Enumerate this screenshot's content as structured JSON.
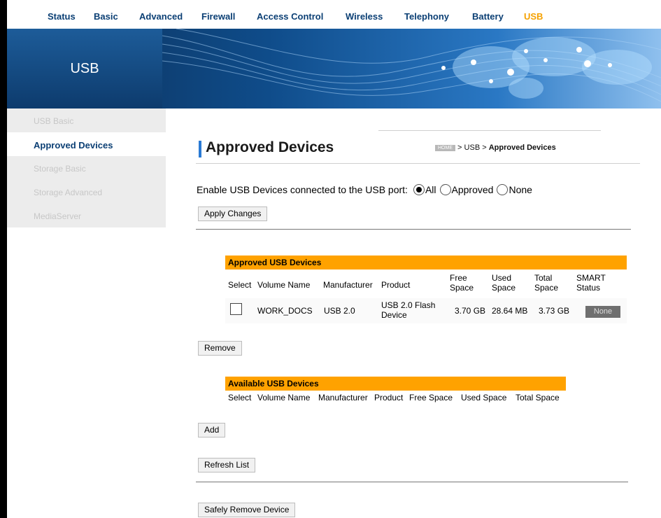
{
  "nav": [
    "Status",
    "Basic",
    "Advanced",
    "Firewall",
    "Access Control",
    "Wireless",
    "Telephony",
    "Battery",
    "USB"
  ],
  "banner": {
    "title": "USB"
  },
  "sidebar": [
    "USB Basic",
    "Approved Devices",
    "Storage Basic",
    "Storage Advanced",
    "MediaServer"
  ],
  "page": {
    "title": "Approved Devices"
  },
  "breadcrumb": {
    "home": "HOME",
    "trail": " > USB > ",
    "current": "Approved Devices"
  },
  "enable": {
    "label": "Enable USB Devices connected to the USB port:",
    "options": [
      "All",
      "Approved",
      "None"
    ],
    "selected": "All"
  },
  "buttons": {
    "apply": "Apply Changes",
    "remove": "Remove",
    "add": "Add",
    "refresh": "Refresh List",
    "safely_remove": "Safely Remove Device"
  },
  "approved": {
    "title": "Approved USB Devices",
    "columns": [
      "Select",
      "Volume Name",
      "Manufacturer",
      "Product",
      "Free Space",
      "Used Space",
      "Total Space",
      "SMART Status"
    ],
    "rows": [
      {
        "volume": "WORK_DOCS",
        "manufacturer": "USB 2.0",
        "product": "USB 2.0 Flash Device",
        "free": "3.70 GB",
        "used": "28.64 MB",
        "total": "3.73 GB",
        "smart": "None"
      }
    ]
  },
  "available": {
    "title": "Available USB Devices",
    "columns": [
      "Select",
      "Volume Name",
      "Manufacturer",
      "Product",
      "Free Space",
      "Used Space",
      "Total Space"
    ]
  },
  "colors": {
    "nav": "#0b3f74",
    "active": "#f5a100",
    "header": "#ffa200",
    "accent": "#2a7ad4"
  }
}
